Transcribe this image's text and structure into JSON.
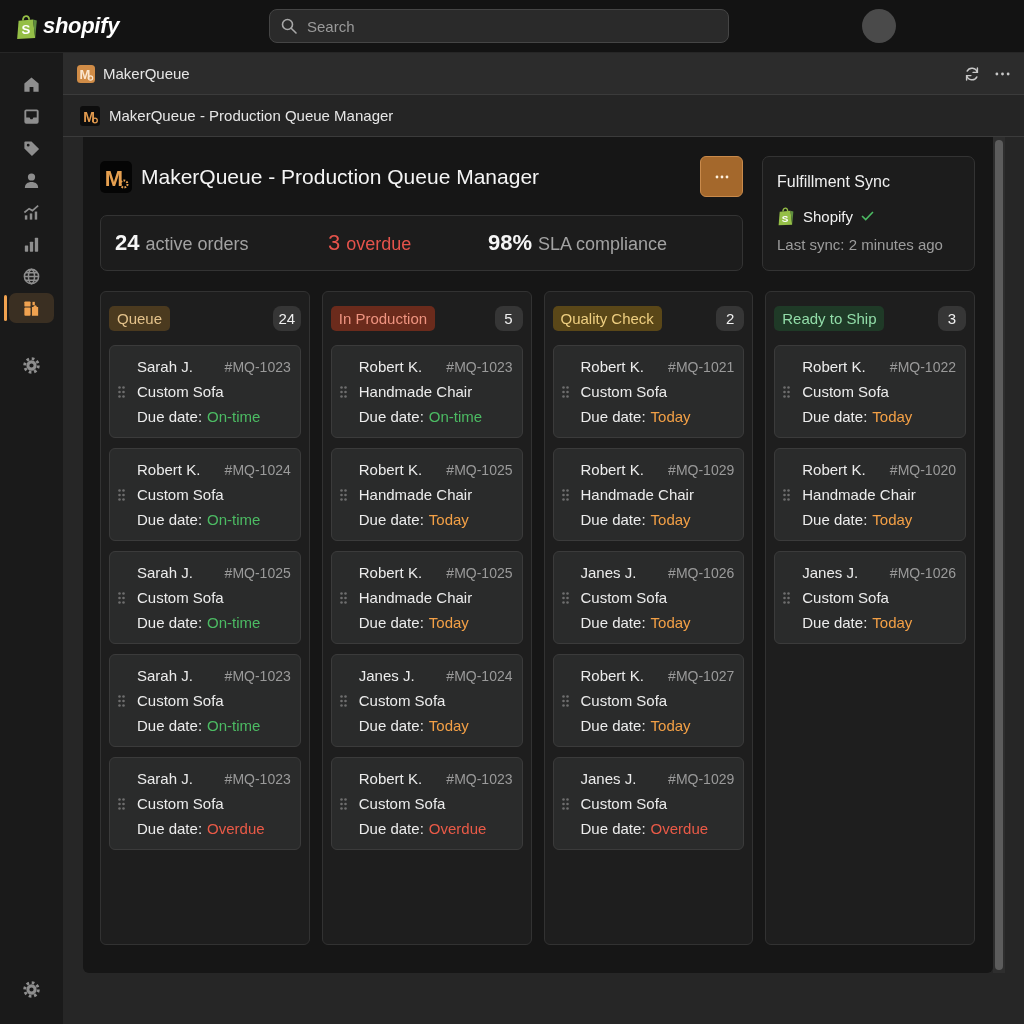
{
  "top_bar": {
    "logo": {
      "mark": "S",
      "wordmark": "shopify"
    },
    "search": {
      "placeholder": "Search"
    }
  },
  "sidebar": {
    "items": [
      {
        "kind": "home",
        "selected": false
      },
      {
        "kind": "inbox",
        "selected": false
      },
      {
        "kind": "tag",
        "selected": false
      },
      {
        "kind": "person",
        "selected": false
      },
      {
        "kind": "trend",
        "selected": false
      },
      {
        "kind": "bars",
        "selected": false
      },
      {
        "kind": "globe",
        "selected": false
      },
      {
        "kind": "apps",
        "selected": true
      }
    ],
    "settings": [
      {
        "kind": "settings",
        "selected": false
      }
    ],
    "footer": [
      {
        "kind": "settings",
        "selected": false
      }
    ]
  },
  "app_bar": {
    "logo_letter": "M",
    "title": "MakerQueue"
  },
  "title_bar": {
    "logo_letter": "M",
    "title": "MakerQueue - Production Queue Manager"
  },
  "header": {
    "logo_letter": "M",
    "title": "MakerQueue - Production Queue Manager"
  },
  "stats": [
    {
      "value": "24",
      "label": "active orders",
      "kind": "normal"
    },
    {
      "value": "3",
      "label": "overdue",
      "kind": "alert"
    },
    {
      "value": "98%",
      "label": "SLA compliance",
      "kind": "normal"
    }
  ],
  "fulfillment": {
    "title": "Fulfillment Sync",
    "platform_mark": "S",
    "platform": "Shopify",
    "synced": true,
    "last_sync": "Last sync: 2 minutes ago"
  },
  "columns": [
    {
      "title": "Queue",
      "count": "24",
      "color": "#4b3a1f",
      "cards": [
        {
          "customer": "Sarah J.",
          "order": "#MQ-1023",
          "product": "Custom Sofa",
          "due_label": "Due date:",
          "status": "On-time",
          "color": "#4cbb63"
        },
        {
          "customer": "Robert K.",
          "order": "#MQ-1024",
          "product": "Custom Sofa",
          "due_label": "Due date:",
          "status": "On-time",
          "color": "#4cbb63"
        },
        {
          "customer": "Sarah J.",
          "order": "#MQ-1025",
          "product": "Custom Sofa",
          "due_label": "Due date:",
          "status": "On-time",
          "color": "#4cbb63"
        },
        {
          "customer": "Sarah J.",
          "order": "#MQ-1023",
          "product": "Custom Sofa",
          "due_label": "Due date:",
          "status": "On-time",
          "color": "#4cbb63"
        },
        {
          "customer": "Sarah J.",
          "order": "#MQ-1023",
          "product": "Custom Sofa",
          "due_label": "Due date:",
          "status": "Overdue",
          "color": "#ea5a47"
        }
      ]
    },
    {
      "title": "In Production",
      "count": "5",
      "color": "#6b2b1c",
      "cards": [
        {
          "customer": "Robert K.",
          "order": "#MQ-1023",
          "product": "Handmade Chair",
          "due_label": "Due date:",
          "status": "On-time",
          "color": "#4cbb63"
        },
        {
          "customer": "Robert K.",
          "order": "#MQ-1025",
          "product": "Handmade Chair",
          "due_label": "Due date:",
          "status": "Today",
          "color": "#f3a046"
        },
        {
          "customer": "Robert K.",
          "order": "#MQ-1025",
          "product": "Handmade Chair",
          "due_label": "Due date:",
          "status": "Today",
          "color": "#f3a046"
        },
        {
          "customer": "Janes J.",
          "order": "#MQ-1024",
          "product": "Custom Sofa",
          "due_label": "Due date:",
          "status": "Today",
          "color": "#f3a046"
        },
        {
          "customer": "Robert K.",
          "order": "#MQ-1023",
          "product": "Custom Sofa",
          "due_label": "Due date:",
          "status": "Overdue",
          "color": "#ea5a47"
        }
      ]
    },
    {
      "title": "Quality Check",
      "count": "2",
      "color": "#5a4718",
      "cards": [
        {
          "customer": "Robert K.",
          "order": "#MQ-1021",
          "product": "Custom Sofa",
          "due_label": "Due date:",
          "status": "Today",
          "color": "#f3a046"
        },
        {
          "customer": "Robert K.",
          "order": "#MQ-1029",
          "product": "Handmade Chair",
          "due_label": "Due date:",
          "status": "Today",
          "color": "#f3a046"
        },
        {
          "customer": "Janes J.",
          "order": "#MQ-1026",
          "product": "Custom Sofa",
          "due_label": "Due date:",
          "status": "Today",
          "color": "#f3a046"
        },
        {
          "customer": "Robert K.",
          "order": "#MQ-1027",
          "product": "Custom Sofa",
          "due_label": "Due date:",
          "status": "Today",
          "color": "#f3a046"
        },
        {
          "customer": "Janes J.",
          "order": "#MQ-1029",
          "product": "Custom Sofa",
          "due_label": "Due date:",
          "status": "Overdue",
          "color": "#ea5a47"
        }
      ]
    },
    {
      "title": "Ready to Ship",
      "count": "3",
      "color": "#1f3a27",
      "cards": [
        {
          "customer": "Robert K.",
          "order": "#MQ-1022",
          "product": "Custom Sofa",
          "due_label": "Due date:",
          "status": "Today",
          "color": "#f3a046"
        },
        {
          "customer": "Robert K.",
          "order": "#MQ-1020",
          "product": "Handmade Chair",
          "due_label": "Due date:",
          "status": "Today",
          "color": "#f3a046"
        },
        {
          "customer": "Janes J.",
          "order": "#MQ-1026",
          "product": "Custom Sofa",
          "due_label": "Due date:",
          "status": "Today",
          "color": "#f3a046"
        }
      ]
    }
  ]
}
